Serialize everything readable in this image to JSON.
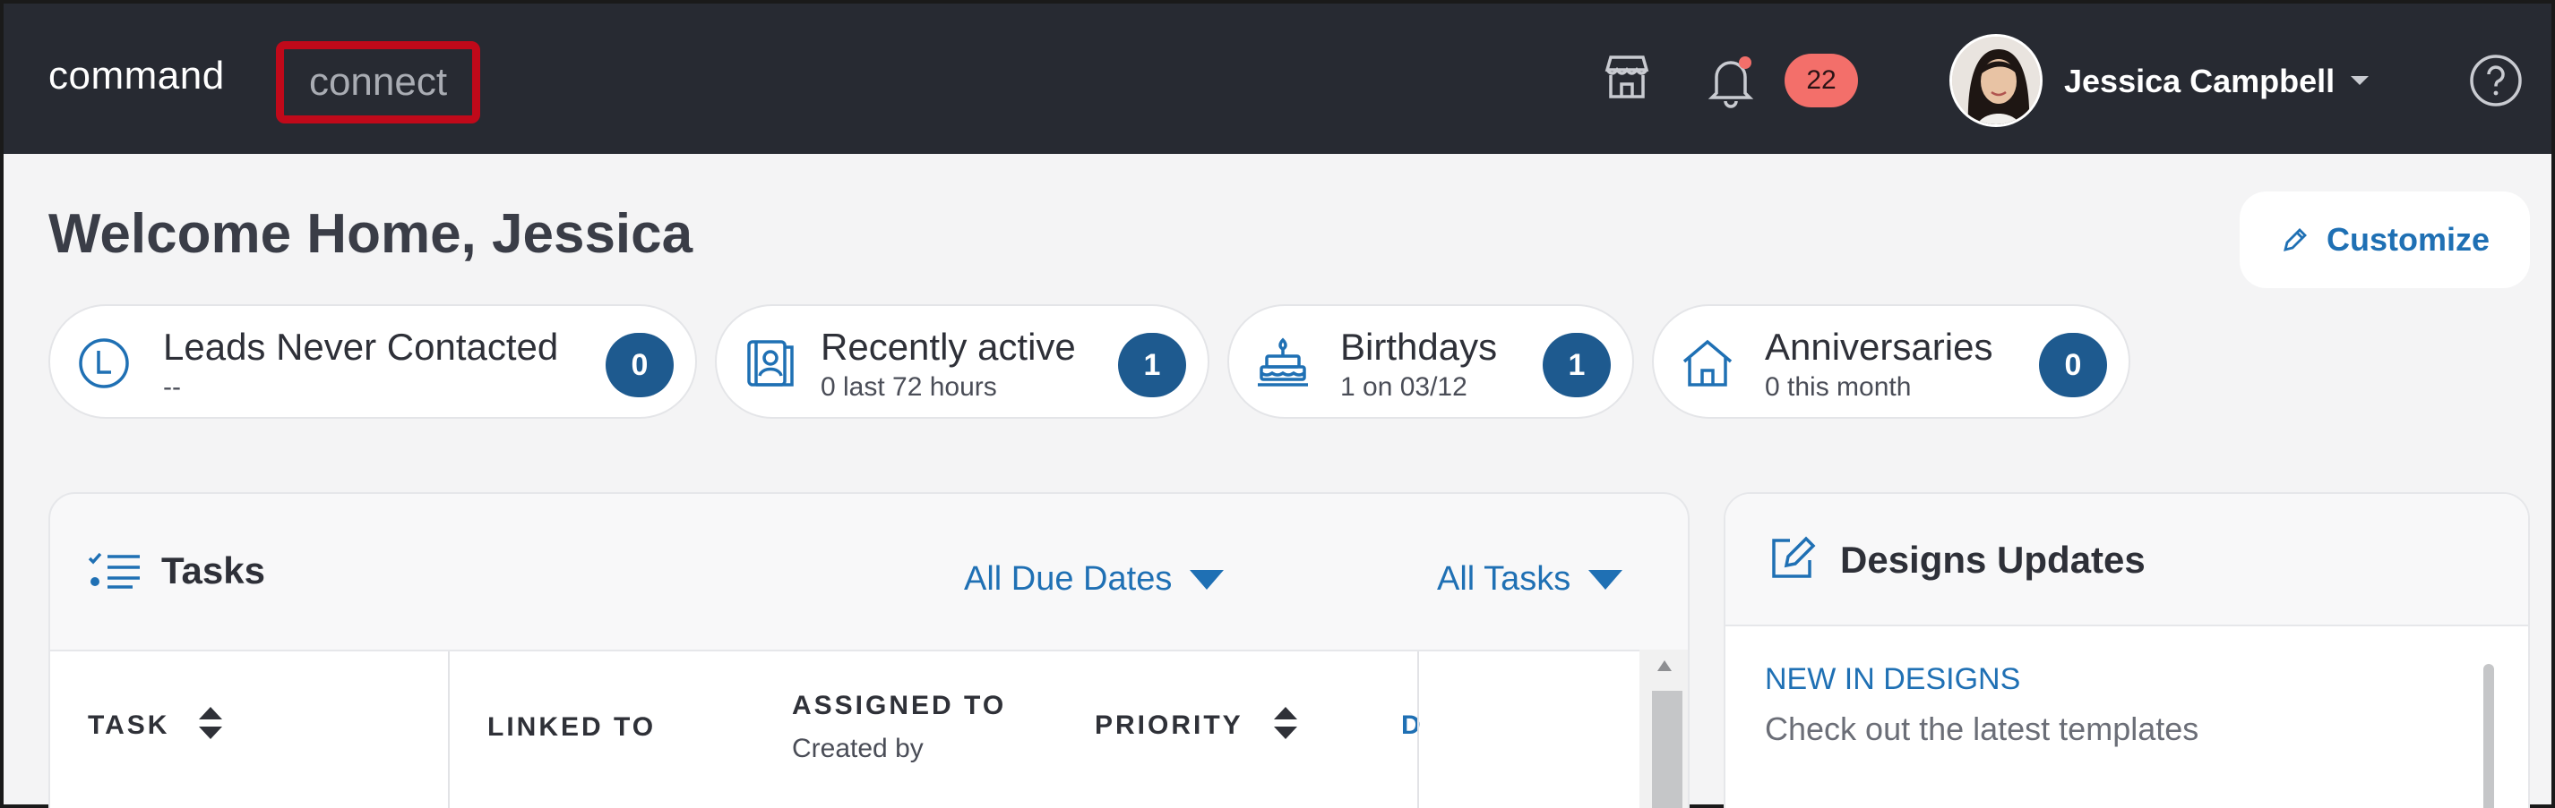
{
  "header": {
    "brand_command": "command",
    "brand_connect": "connect",
    "notification_count": "22",
    "user_name": "Jessica Campbell",
    "icons": [
      "store-icon",
      "bell-icon",
      "chevron-down-icon",
      "help-icon"
    ]
  },
  "page": {
    "welcome": "Welcome Home, Jessica",
    "customize_label": "Customize"
  },
  "stats": [
    {
      "title": "Leads Never Contacted",
      "sub": "--",
      "count": "0",
      "icon": "clock-l-icon"
    },
    {
      "title": "Recently active",
      "sub": "0 last 72 hours",
      "count": "1",
      "icon": "contact-card-icon"
    },
    {
      "title": "Birthdays",
      "sub": "1 on 03/12",
      "count": "1",
      "icon": "cake-icon"
    },
    {
      "title": "Anniversaries",
      "sub": "0 this month",
      "count": "0",
      "icon": "house-icon"
    }
  ],
  "tasks": {
    "title": "Tasks",
    "filter_due": "All Due Dates",
    "filter_tasks": "All Tasks",
    "columns": {
      "task": "TASK",
      "linked_to": "LINKED TO",
      "assigned_to": "ASSIGNED TO",
      "created_by": "Created by",
      "priority": "PRIORITY",
      "truncated": "D"
    }
  },
  "designs": {
    "title": "Designs Updates",
    "new_label": "NEW IN DESIGNS",
    "description": "Check out the latest templates"
  },
  "colors": {
    "topbar": "#272a32",
    "accent_blue": "#1f70b4",
    "badge_red": "#f36f6a",
    "count_blue": "#1e5a8f",
    "highlight_red": "#c0091a"
  }
}
